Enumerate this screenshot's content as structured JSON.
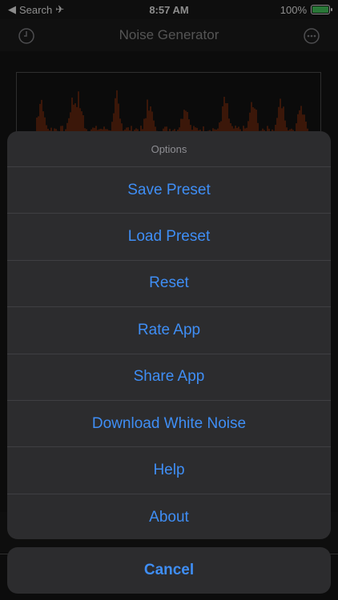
{
  "status_bar": {
    "back_label": "Search",
    "time": "8:57 AM",
    "battery_percent": "100%"
  },
  "navbar": {
    "title": "Noise Generator",
    "left_icon": "clock-icon",
    "right_icon": "more-icon"
  },
  "action_sheet": {
    "title": "Options",
    "items": [
      {
        "label": "Save Preset"
      },
      {
        "label": "Load Preset"
      },
      {
        "label": "Reset"
      },
      {
        "label": "Rate App"
      },
      {
        "label": "Share App"
      },
      {
        "label": "Download White Noise"
      },
      {
        "label": "Help"
      },
      {
        "label": "About"
      }
    ],
    "cancel_label": "Cancel"
  },
  "colors": {
    "accent": "#3f8ef5",
    "sheet_bg": "#2c2c2e",
    "spectrum": "#c4410e"
  }
}
